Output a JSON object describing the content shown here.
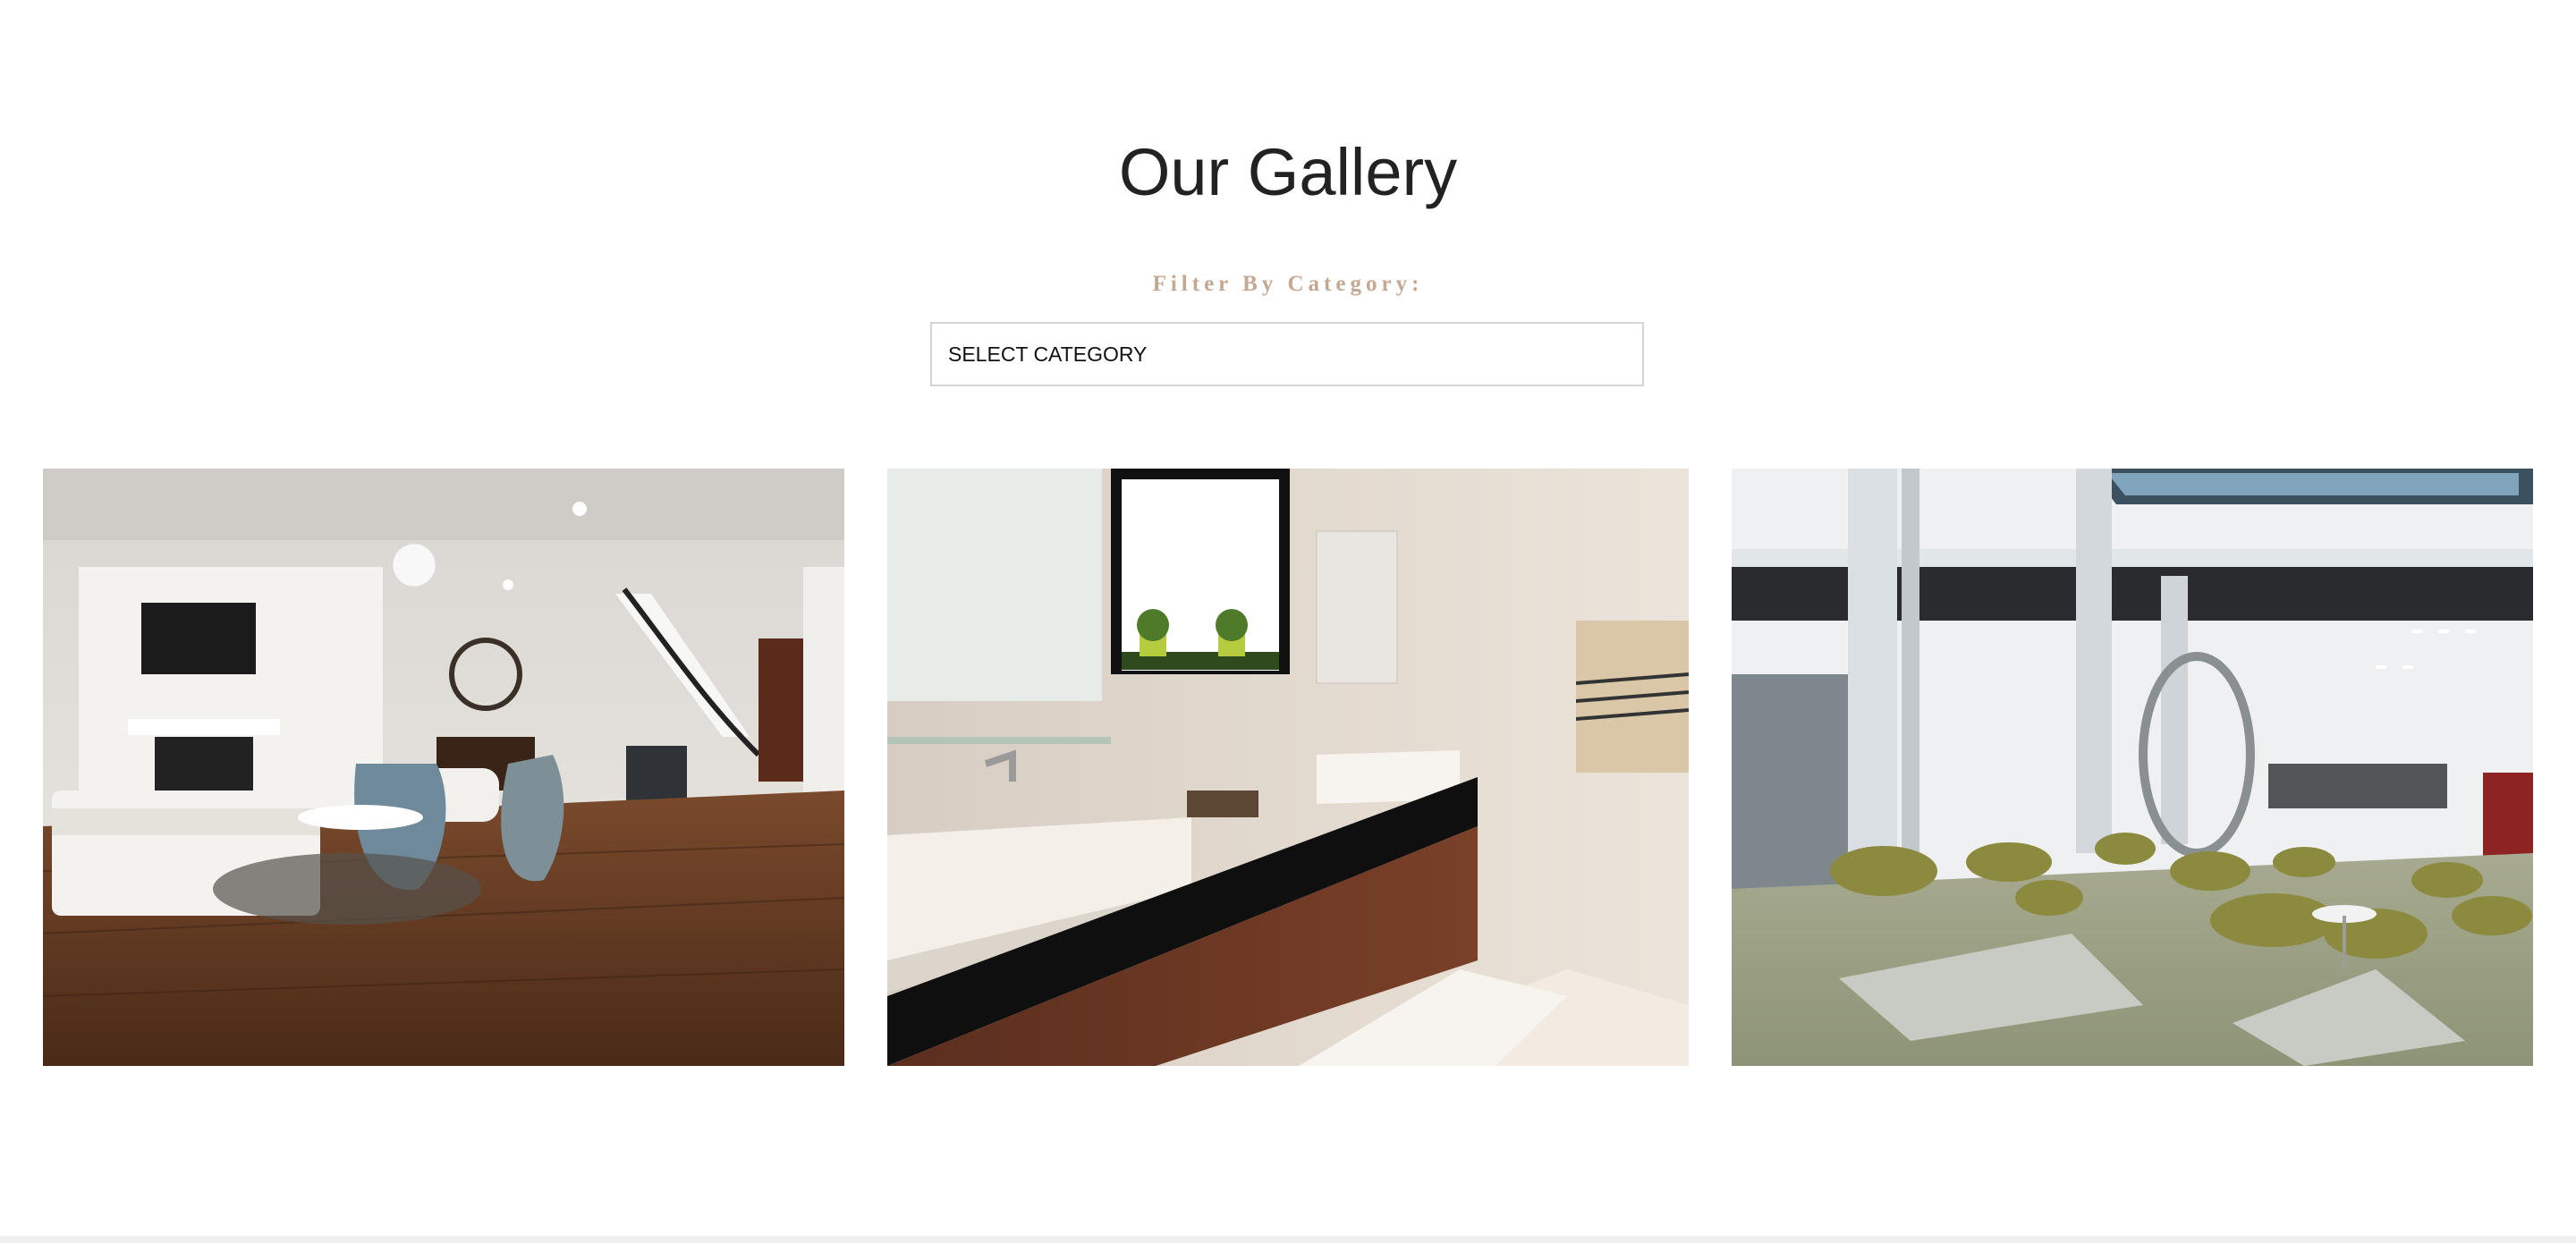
{
  "gallery": {
    "title": "Our Gallery",
    "filter_label": "Filter By Category:",
    "select": {
      "selected": "SELECT CATEGORY"
    },
    "images": [
      {
        "name": "living-room-image"
      },
      {
        "name": "bathroom-image"
      },
      {
        "name": "office-lobby-image"
      }
    ]
  },
  "colors": {
    "title": "#222222",
    "filter_label": "#c4a892",
    "select_border": "#d4d4d4"
  }
}
